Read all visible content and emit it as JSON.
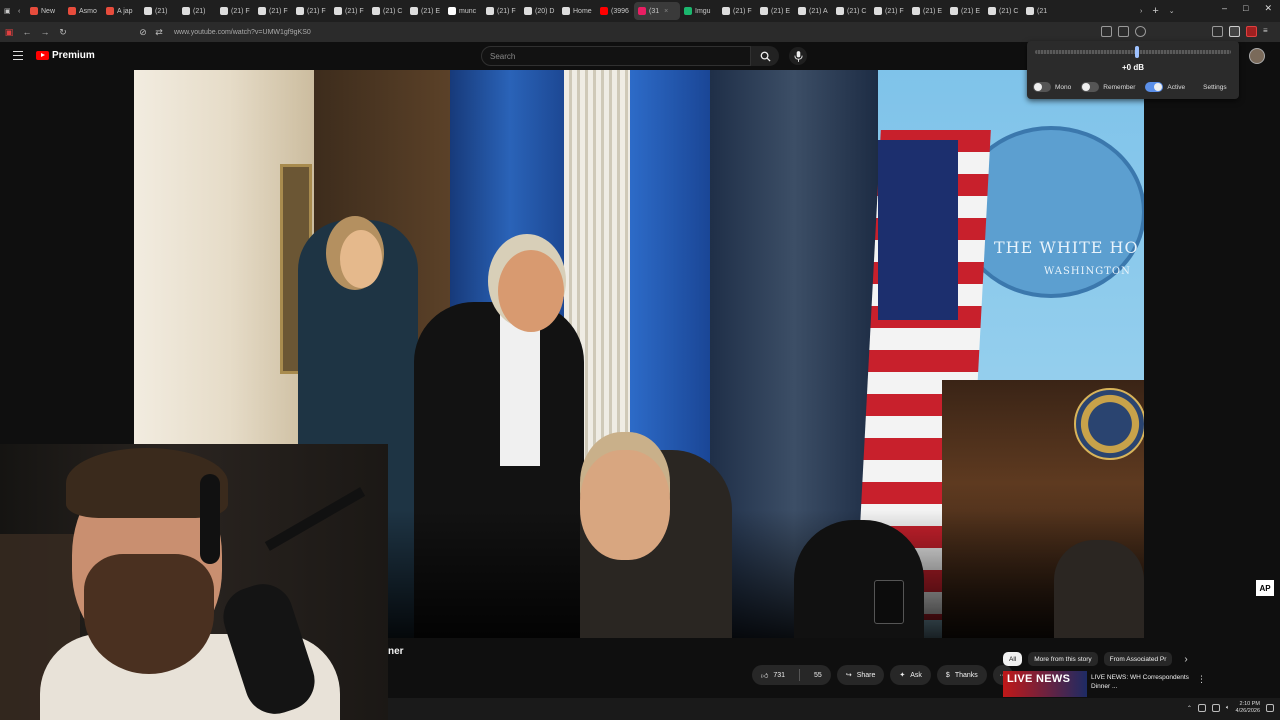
{
  "tabs": [
    {
      "label": "New",
      "color": "#e74c3c",
      "active": false
    },
    {
      "label": "Asmo",
      "color": "#e74c3c",
      "active": false
    },
    {
      "label": "A jap",
      "color": "#e74c3c",
      "active": false
    },
    {
      "label": "(21)",
      "color": "#dddddd",
      "active": false
    },
    {
      "label": "(21)",
      "color": "#dddddd",
      "active": false
    },
    {
      "label": "(21) F",
      "color": "#dddddd",
      "active": false
    },
    {
      "label": "(21) F",
      "color": "#dddddd",
      "active": false
    },
    {
      "label": "(21) F",
      "color": "#dddddd",
      "active": false
    },
    {
      "label": "(21) F",
      "color": "#dddddd",
      "active": false
    },
    {
      "label": "(21) C",
      "color": "#dddddd",
      "active": false
    },
    {
      "label": "(21) E",
      "color": "#dddddd",
      "active": false
    },
    {
      "label": "munc",
      "color": "#ffffff",
      "active": false
    },
    {
      "label": "(21) F",
      "color": "#dddddd",
      "active": false
    },
    {
      "label": "(20) D",
      "color": "#dddddd",
      "active": false
    },
    {
      "label": "Home",
      "color": "#dddddd",
      "active": false
    },
    {
      "label": "(3996",
      "color": "#ff0000",
      "active": false
    },
    {
      "label": "(31",
      "color": "#e91e63",
      "active": true
    },
    {
      "label": "Imgu",
      "color": "#1bb76e",
      "active": false
    },
    {
      "label": "(21) F",
      "color": "#dddddd",
      "active": false
    },
    {
      "label": "(21) E",
      "color": "#dddddd",
      "active": false
    },
    {
      "label": "(21) A",
      "color": "#dddddd",
      "active": false
    },
    {
      "label": "(21) C",
      "color": "#dddddd",
      "active": false
    },
    {
      "label": "(21) F",
      "color": "#dddddd",
      "active": false
    },
    {
      "label": "(21) E",
      "color": "#dddddd",
      "active": false
    },
    {
      "label": "(21) E",
      "color": "#dddddd",
      "active": false
    },
    {
      "label": "(21) C",
      "color": "#dddddd",
      "active": false
    },
    {
      "label": "(21",
      "color": "#dddddd",
      "active": false
    }
  ],
  "window_controls": {
    "minimize": "–",
    "maximize": "□",
    "close": "✕"
  },
  "address": {
    "url": "www.youtube.com/watch?v=UMW1gf9gKS0"
  },
  "youtube": {
    "brand": "Premium",
    "search_placeholder": "Search"
  },
  "video": {
    "sign_line1": "THE WHITE HO",
    "sign_line2": "WASHINGTON",
    "corner_badge": "AP"
  },
  "title_fragment": "ner",
  "actions": {
    "likes": "731",
    "dislikes": "55",
    "share": "Share",
    "ask": "Ask",
    "thanks": "Thanks",
    "more": "···"
  },
  "chips": [
    "All",
    "More from this story",
    "From Associated Pr"
  ],
  "recommendation": {
    "thumb_label": "LIVE NEWS",
    "title": "LIVE NEWS: WH Correspondents Dinner ..."
  },
  "audio_popup": {
    "level": 0.5,
    "db": "+0 dB",
    "toggles": [
      {
        "label": "Mono",
        "on": false
      },
      {
        "label": "Remember",
        "on": false
      },
      {
        "label": "Active",
        "on": true
      }
    ],
    "settings": "Settings"
  },
  "taskbar": {
    "time": "2:10 PM",
    "date": "4/26/2026"
  }
}
